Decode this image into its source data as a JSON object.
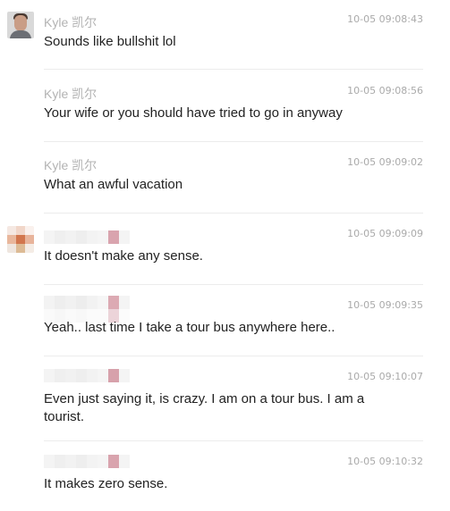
{
  "messages": [
    {
      "sender": "Kyle 凯尔",
      "time": "10-05 09:08:43",
      "text": "Sounds like bullshit lol",
      "avatar": "user-photo"
    },
    {
      "sender": "Kyle 凯尔",
      "time": "10-05 09:08:56",
      "text": "Your wife or you should have tried to go in anyway"
    },
    {
      "sender": "Kyle 凯尔",
      "time": "10-05 09:09:02",
      "text": "What an awful vacation"
    },
    {
      "sender": "",
      "time": "10-05 09:09:09",
      "text": "It doesn't make any sense.",
      "avatar": "pixelated-avatar"
    },
    {
      "sender": "",
      "time": "10-05 09:09:35",
      "text": "Yeah.. last time I take a tour bus anywhere here.."
    },
    {
      "sender": "",
      "time": "10-05 09:10:07",
      "text": "Even just saying it, is crazy. I am on a tour bus. I am a tourist."
    },
    {
      "sender": "",
      "time": "10-05 09:10:32",
      "text": "It makes zero sense."
    }
  ],
  "colors": {
    "sender_gray": "#b3b3b3",
    "time_gray": "#aaaaaa",
    "text_dark": "#222222",
    "divider": "#ececec",
    "blur_pink": "#d9a4ae",
    "blur_light": "#eeeeee"
  }
}
